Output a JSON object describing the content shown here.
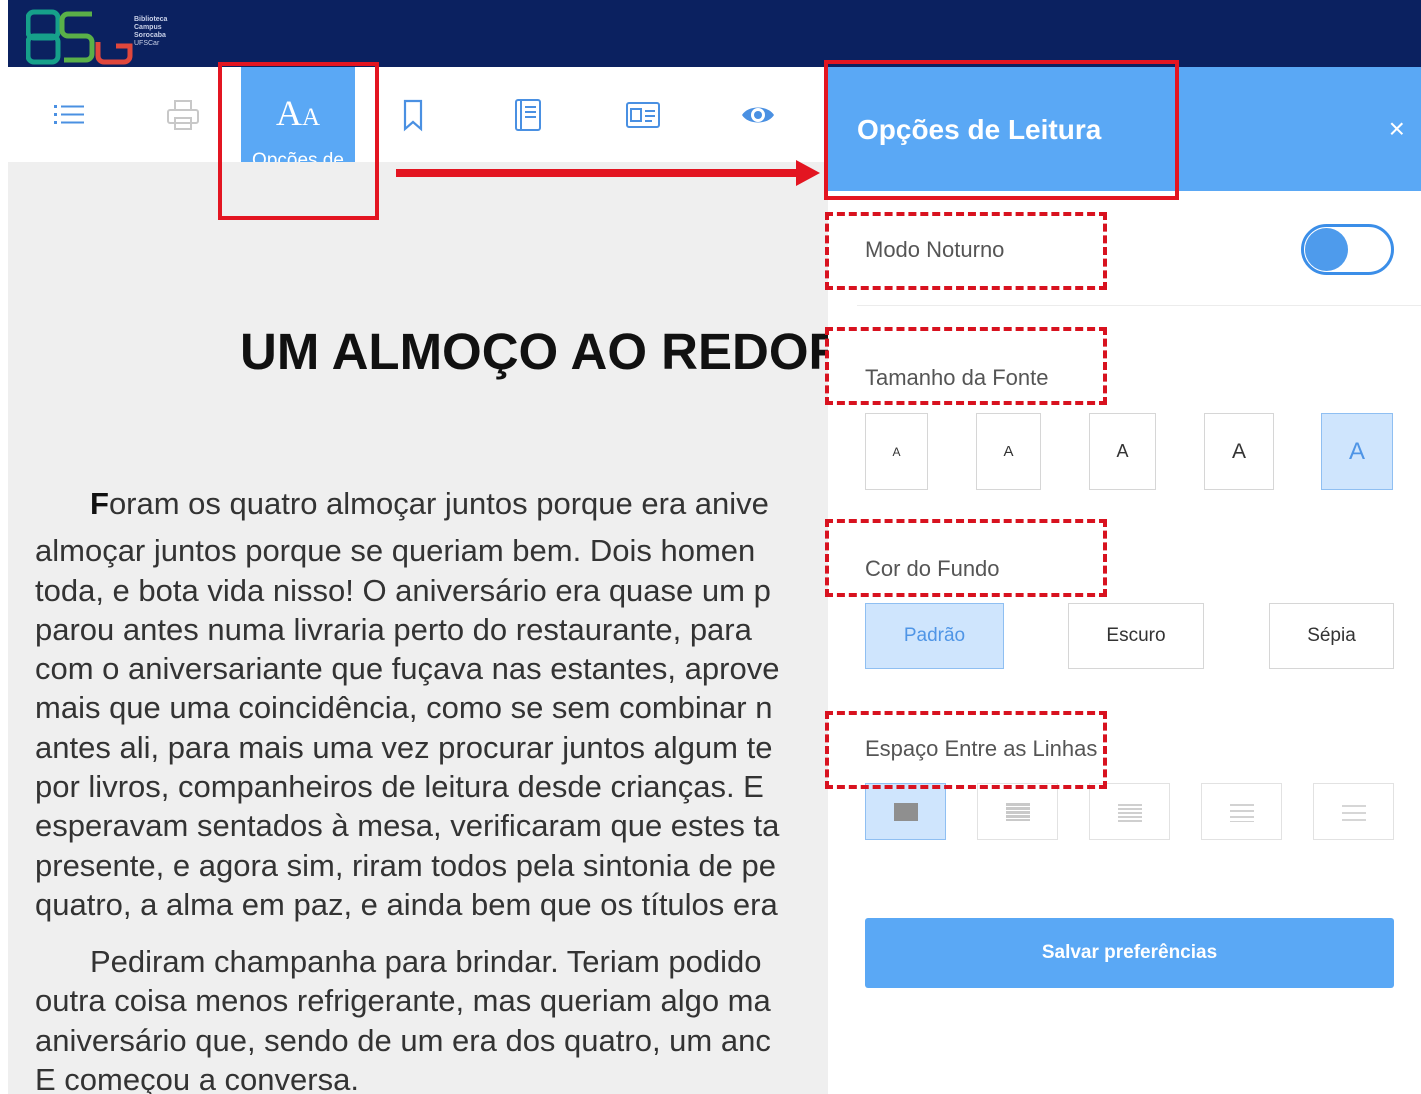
{
  "header": {
    "logo_letters": "BSo",
    "logo_lines": [
      "Biblioteca",
      "Campus",
      "Sorocaba"
    ],
    "logo_org": "UFSCar"
  },
  "toolbar": {
    "items": [
      {
        "name": "summary",
        "icon": "list-icon"
      },
      {
        "name": "print",
        "icon": "printer-icon"
      },
      {
        "name": "reading-options",
        "icon": "font-size-icon",
        "glyph": "A",
        "glyph_small": "A",
        "label": "Opções de Leitura",
        "active": true
      },
      {
        "name": "bookmark",
        "icon": "bookmark-icon"
      },
      {
        "name": "notes",
        "icon": "book-icon"
      },
      {
        "name": "card",
        "icon": "id-card-icon"
      },
      {
        "name": "view",
        "icon": "eye-icon"
      }
    ]
  },
  "document": {
    "title": "UM ALMOÇO AO REDOR",
    "paragraph1": {
      "first_letter": "F",
      "lines": [
        "oram os quatro almoçar juntos porque era anive",
        "almoçar juntos porque se queriam bem. Dois homen",
        "toda, e bota vida nisso! O aniversário era quase um p",
        "parou antes numa livraria perto do restaurante, para",
        "com o aniversariante que fuçava nas estantes, aprove",
        "mais que uma coincidência, como se sem combinar n",
        "antes ali, para mais uma vez procurar juntos algum te",
        "por livros, companheiros de leitura desde crianças. E",
        "esperavam sentados à mesa, verificaram que estes ta",
        "presente, e agora sim, riram todos pela sintonia de pe",
        "quatro, a alma em paz, e ainda bem que os títulos era"
      ]
    },
    "paragraph2": {
      "lines": [
        "Pediram champanha para brindar. Teriam podido",
        "outra coisa menos refrigerante, mas queriam algo ma",
        "aniversário que, sendo de um era dos quatro, um anc",
        "E começou a conversa."
      ]
    }
  },
  "panel": {
    "title": "Opções de Leitura",
    "close": "×",
    "night_mode": {
      "label": "Modo Noturno",
      "enabled": false,
      "accent": "#3b8ee8"
    },
    "font_size": {
      "label": "Tamanho da Fonte",
      "options": [
        "A",
        "A",
        "A",
        "A",
        "A"
      ],
      "selected_index": 4
    },
    "background": {
      "label": "Cor do Fundo",
      "options": [
        "Padrão",
        "Escuro",
        "Sépia"
      ],
      "selected_index": 0
    },
    "line_spacing": {
      "label": "Espaço Entre as Linhas",
      "options_count": 5,
      "selected_index": 0
    },
    "save_label": "Salvar preferências"
  },
  "colors": {
    "header_bg": "#0b2160",
    "accent": "#5aa8f5",
    "selected_bg": "#cfe5fd",
    "annotation_red": "#e31521",
    "reader_bg": "#efefef"
  }
}
